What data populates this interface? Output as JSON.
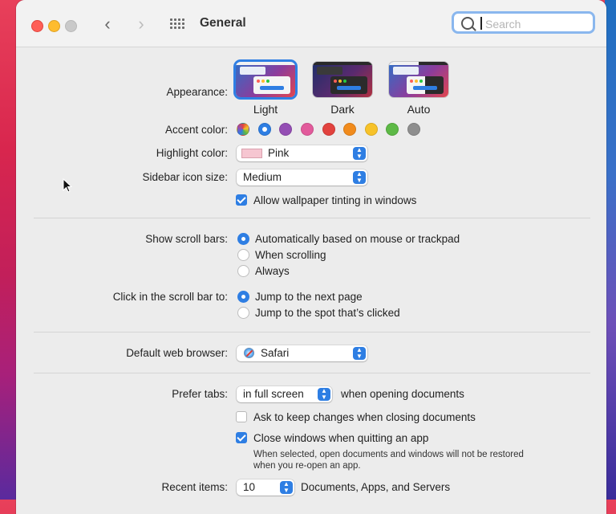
{
  "window": {
    "title": "General"
  },
  "search": {
    "placeholder": "Search"
  },
  "appearance": {
    "label": "Appearance:",
    "options": [
      {
        "name": "Light",
        "selected": true
      },
      {
        "name": "Dark",
        "selected": false
      },
      {
        "name": "Auto",
        "selected": false
      }
    ]
  },
  "accent_color": {
    "label": "Accent color:",
    "colors": [
      "multicolor",
      "#2e7ee3",
      "#944eb4",
      "#e25a9b",
      "#e2423e",
      "#f18b1c",
      "#f7c229",
      "#5db946",
      "#8e8e8e"
    ],
    "selected_index": 1
  },
  "highlight_color": {
    "label": "Highlight color:",
    "value": "Pink",
    "swatch": "#f6c6d1"
  },
  "sidebar_icon_size": {
    "label": "Sidebar icon size:",
    "value": "Medium"
  },
  "wallpaper_tinting": {
    "label": "Allow wallpaper tinting in windows",
    "checked": true
  },
  "scroll_bars": {
    "label": "Show scroll bars:",
    "options": [
      "Automatically based on mouse or trackpad",
      "When scrolling",
      "Always"
    ],
    "selected_index": 0
  },
  "scroll_click": {
    "label": "Click in the scroll bar to:",
    "options": [
      "Jump to the next page",
      "Jump to the spot that’s clicked"
    ],
    "selected_index": 0
  },
  "default_browser": {
    "label": "Default web browser:",
    "value": "Safari"
  },
  "prefer_tabs": {
    "label": "Prefer tabs:",
    "value": "in full screen",
    "suffix": "when opening documents"
  },
  "ask_keep_changes": {
    "label": "Ask to keep changes when closing documents",
    "checked": false
  },
  "close_windows": {
    "label": "Close windows when quitting an app",
    "checked": true,
    "note_line1": "When selected, open documents and windows will not be restored",
    "note_line2": "when you re-open an app."
  },
  "recent_items": {
    "label": "Recent items:",
    "value": "10",
    "suffix": "Documents, Apps, and Servers"
  },
  "colors": {
    "accent": "#2e7ee3",
    "focus_ring": "#8ab7ee"
  }
}
